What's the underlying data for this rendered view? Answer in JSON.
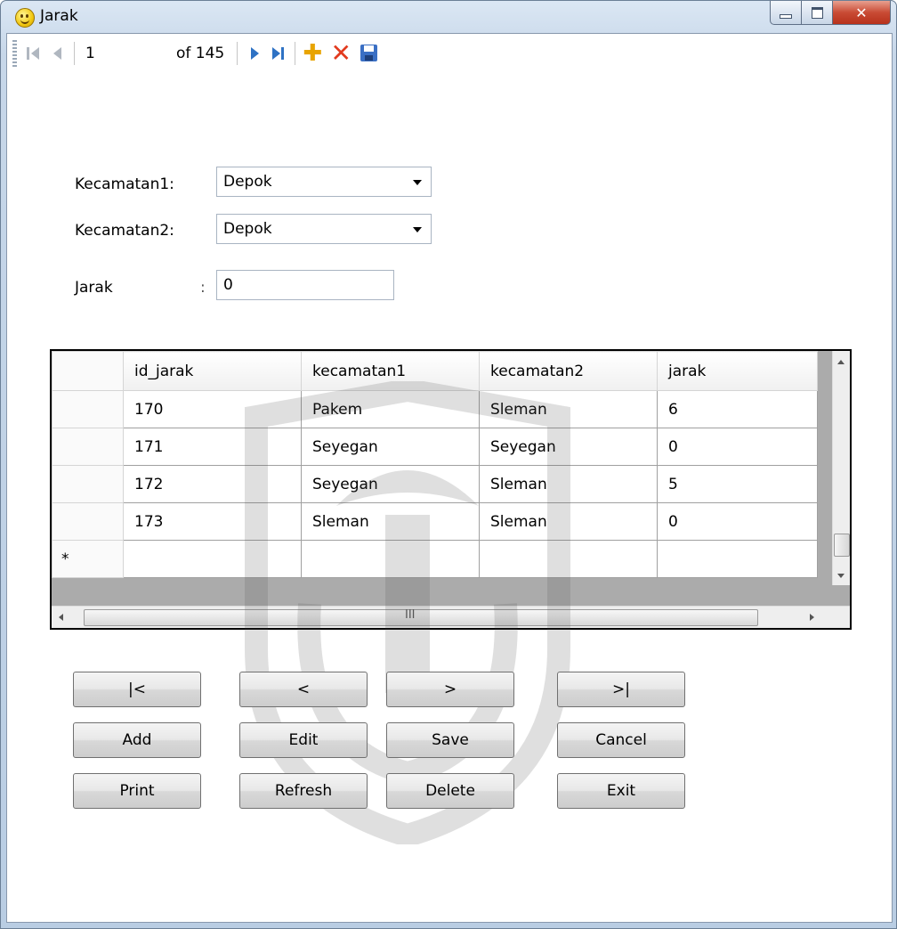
{
  "window": {
    "title": "Jarak"
  },
  "toolbar": {
    "position": "1",
    "of_label": "of 145"
  },
  "form": {
    "kecamatan1_label": "Kecamatan1:",
    "kecamatan1_value": "Depok",
    "kecamatan2_label": "Kecamatan2:",
    "kecamatan2_value": "Depok",
    "jarak_label": "Jarak",
    "jarak_colon": ":",
    "jarak_value": "0"
  },
  "grid": {
    "columns": [
      "id_jarak",
      "kecamatan1",
      "kecamatan2",
      "jarak"
    ],
    "rows": [
      [
        "170",
        "Pakem",
        "Sleman",
        "6"
      ],
      [
        "171",
        "Seyegan",
        "Seyegan",
        "0"
      ],
      [
        "172",
        "Seyegan",
        "Sleman",
        "5"
      ],
      [
        "173",
        "Sleman",
        "Sleman",
        "0"
      ]
    ],
    "new_row_marker": "*",
    "hscroll_grip": "III"
  },
  "buttons": {
    "first": "|<",
    "prev": "<",
    "next": ">",
    "last": ">|",
    "add": "Add",
    "edit": "Edit",
    "save": "Save",
    "cancel": "Cancel",
    "print": "Print",
    "refresh": "Refresh",
    "delete": "Delete",
    "exit": "Exit"
  },
  "icons": {
    "app": "smiley-icon",
    "move_first": "move-first-icon",
    "move_previous": "move-previous-icon",
    "move_next": "move-next-icon",
    "move_last": "move-last-icon",
    "add_new": "add-new-icon",
    "delete": "delete-icon",
    "save": "save-icon"
  },
  "colors": {
    "nav_active": "#2e72c4",
    "nav_disabled": "#b0b7c0",
    "add_icon": "#e8a400",
    "delete_icon": "#e23a1e",
    "grid_background": "#ababab"
  }
}
